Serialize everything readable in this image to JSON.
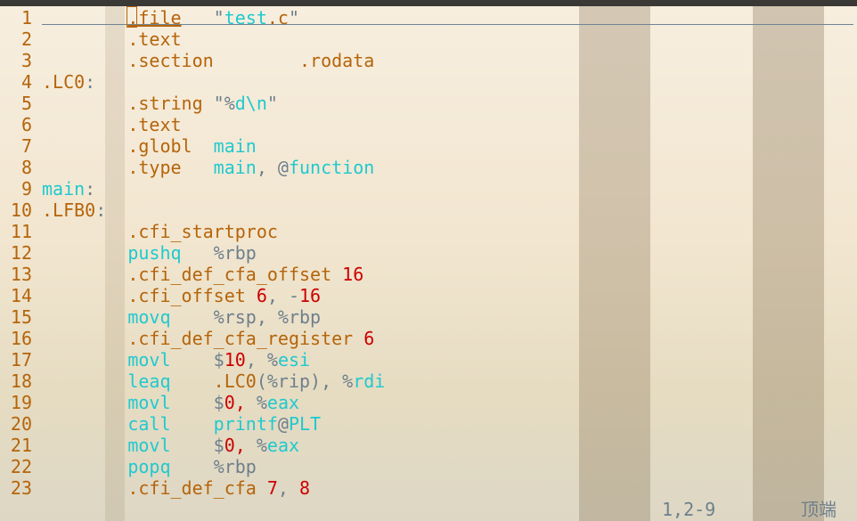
{
  "colors": {
    "directive": "#b5640a",
    "keyword": "#1fc9cf",
    "number": "#cc0000",
    "punct": "#6e7f8c"
  },
  "lines": [
    [
      [
        "        ",
        ""
      ],
      [
        ".file",
        "o"
      ],
      [
        "   \"",
        "g"
      ],
      [
        "test",
        "c"
      ],
      [
        ".c",
        "o"
      ],
      [
        "\"",
        "g"
      ]
    ],
    [
      [
        "        ",
        ""
      ],
      [
        ".text",
        "o"
      ]
    ],
    [
      [
        "        ",
        ""
      ],
      [
        ".section        .rodata",
        "o"
      ]
    ],
    [
      [
        ".LC0",
        "o"
      ],
      [
        ":",
        "g"
      ]
    ],
    [
      [
        "        ",
        ""
      ],
      [
        ".string",
        "o"
      ],
      [
        " \"%",
        "g"
      ],
      [
        "d\\n",
        "c"
      ],
      [
        "\"",
        "g"
      ]
    ],
    [
      [
        "        ",
        ""
      ],
      [
        ".text",
        "o"
      ]
    ],
    [
      [
        "        ",
        ""
      ],
      [
        ".globl",
        "o"
      ],
      [
        "  main",
        "c"
      ]
    ],
    [
      [
        "        ",
        ""
      ],
      [
        ".type",
        "o"
      ],
      [
        "   main",
        "c"
      ],
      [
        ", @",
        "g"
      ],
      [
        "function",
        "c"
      ]
    ],
    [
      [
        "main",
        "c"
      ],
      [
        ":",
        "g"
      ]
    ],
    [
      [
        ".LFB0",
        "o"
      ],
      [
        ":",
        "g"
      ]
    ],
    [
      [
        "        ",
        ""
      ],
      [
        ".cfi_startproc",
        "o"
      ]
    ],
    [
      [
        "        ",
        ""
      ],
      [
        "pushq",
        "c"
      ],
      [
        "   %rbp",
        "g"
      ]
    ],
    [
      [
        "        ",
        ""
      ],
      [
        ".cfi_def_cfa_offset ",
        "o"
      ],
      [
        "16",
        "r"
      ]
    ],
    [
      [
        "        ",
        ""
      ],
      [
        ".cfi_offset ",
        "o"
      ],
      [
        "6",
        "r"
      ],
      [
        ", -",
        "g"
      ],
      [
        "16",
        "r"
      ]
    ],
    [
      [
        "        ",
        ""
      ],
      [
        "movq",
        "c"
      ],
      [
        "    %rsp, %rbp",
        "g"
      ]
    ],
    [
      [
        "        ",
        ""
      ],
      [
        ".cfi_def_cfa_register ",
        "o"
      ],
      [
        "6",
        "r"
      ]
    ],
    [
      [
        "        ",
        ""
      ],
      [
        "movl",
        "c"
      ],
      [
        "    $",
        "g"
      ],
      [
        "10",
        "r"
      ],
      [
        ", %",
        "g"
      ],
      [
        "esi",
        "c"
      ]
    ],
    [
      [
        "        ",
        ""
      ],
      [
        "leaq",
        "c"
      ],
      [
        "    ",
        "g"
      ],
      [
        ".LC0",
        "o"
      ],
      [
        "(%rip), %",
        "g"
      ],
      [
        "rdi",
        "c"
      ]
    ],
    [
      [
        "        ",
        ""
      ],
      [
        "movl",
        "c"
      ],
      [
        "    $",
        "g"
      ],
      [
        "0,",
        "r"
      ],
      [
        " %",
        "g"
      ],
      [
        "eax",
        "c"
      ]
    ],
    [
      [
        "        ",
        ""
      ],
      [
        "call",
        "c"
      ],
      [
        "    printf",
        "c"
      ],
      [
        "@",
        "g"
      ],
      [
        "PLT",
        "c"
      ]
    ],
    [
      [
        "        ",
        ""
      ],
      [
        "movl",
        "c"
      ],
      [
        "    $",
        "g"
      ],
      [
        "0,",
        "r"
      ],
      [
        " %",
        "g"
      ],
      [
        "eax",
        "c"
      ]
    ],
    [
      [
        "        ",
        ""
      ],
      [
        "popq",
        "c"
      ],
      [
        "    %rbp",
        "g"
      ]
    ],
    [
      [
        "        ",
        ""
      ],
      [
        ".cfi_def_cfa ",
        "o"
      ],
      [
        "7",
        "r"
      ],
      [
        ", ",
        "g"
      ],
      [
        "8",
        "r"
      ]
    ]
  ],
  "status": {
    "position": "1,2-9",
    "scroll": "顶端"
  }
}
